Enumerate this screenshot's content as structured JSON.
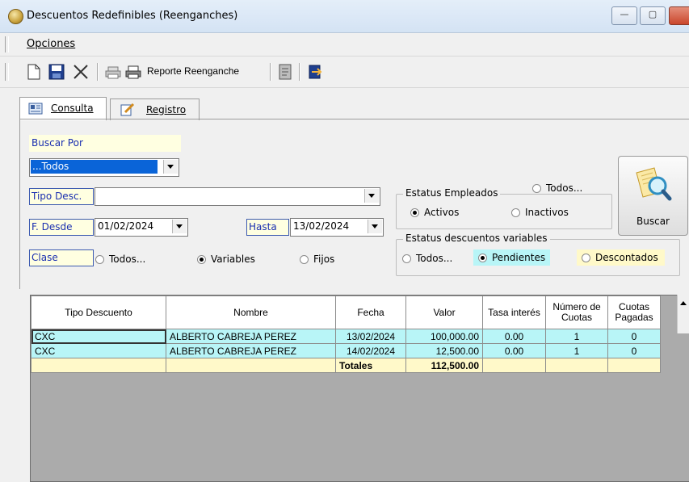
{
  "window": {
    "title": "Descuentos Redefinibles (Reenganches)"
  },
  "menu": {
    "opciones": "Opciones"
  },
  "toolbar": {
    "report_label": "Reporte Reenganche"
  },
  "tabs": {
    "consulta": "Consulta",
    "registro": "Registro"
  },
  "search": {
    "buscar_por_label": "Buscar Por",
    "buscar_por_value": "...Todos",
    "tipo_desc_label": "Tipo Desc.",
    "tipo_desc_value": "",
    "f_desde_label": "F. Desde",
    "f_desde_value": "01/02/2024",
    "hasta_label": "Hasta",
    "hasta_value": "13/02/2024",
    "clase_label": "Clase",
    "clase_options": [
      "Todos...",
      "Variables",
      "Fijos"
    ],
    "clase_selected": "Variables",
    "estatus_empleados_label": "Estatus Empleados",
    "estatus_empleados_options": [
      "Todos...",
      "Activos",
      "Inactivos"
    ],
    "estatus_empleados_selected": "Activos",
    "estatus_descuentos_label": "Estatus descuentos variables",
    "estatus_descuentos_options": [
      "Todos...",
      "Pendientes",
      "Descontados"
    ],
    "estatus_descuentos_selected": "Pendientes",
    "buscar_button": "Buscar"
  },
  "grid": {
    "headers": [
      "Tipo Descuento",
      "Nombre",
      "Fecha",
      "Valor",
      "Tasa interés",
      "Número de Cuotas",
      "Cuotas Pagadas"
    ],
    "rows": [
      [
        "CXC",
        "ALBERTO CABREJA PEREZ",
        "13/02/2024",
        "100,000.00",
        "0.00",
        "1",
        "0"
      ],
      [
        "CXC",
        "ALBERTO CABREJA PEREZ",
        "14/02/2024",
        "12,500.00",
        "0.00",
        "1",
        "0"
      ]
    ],
    "totals_label": "Totales",
    "totals_value": "112,500.00"
  },
  "colors": {
    "row_bg": "#b8f5f7",
    "totals_bg": "#fff9c9",
    "label_bg": "#ffffe1",
    "selection": "#0a64d8"
  },
  "icons": [
    "app-coin-icon",
    "new-document-icon",
    "save-disk-icon",
    "delete-x-icon",
    "print-preview-icon",
    "print-icon",
    "notes-icon",
    "exit-door-icon",
    "consulta-tab-icon",
    "registro-tab-icon",
    "buscar-magnifier-icon"
  ]
}
